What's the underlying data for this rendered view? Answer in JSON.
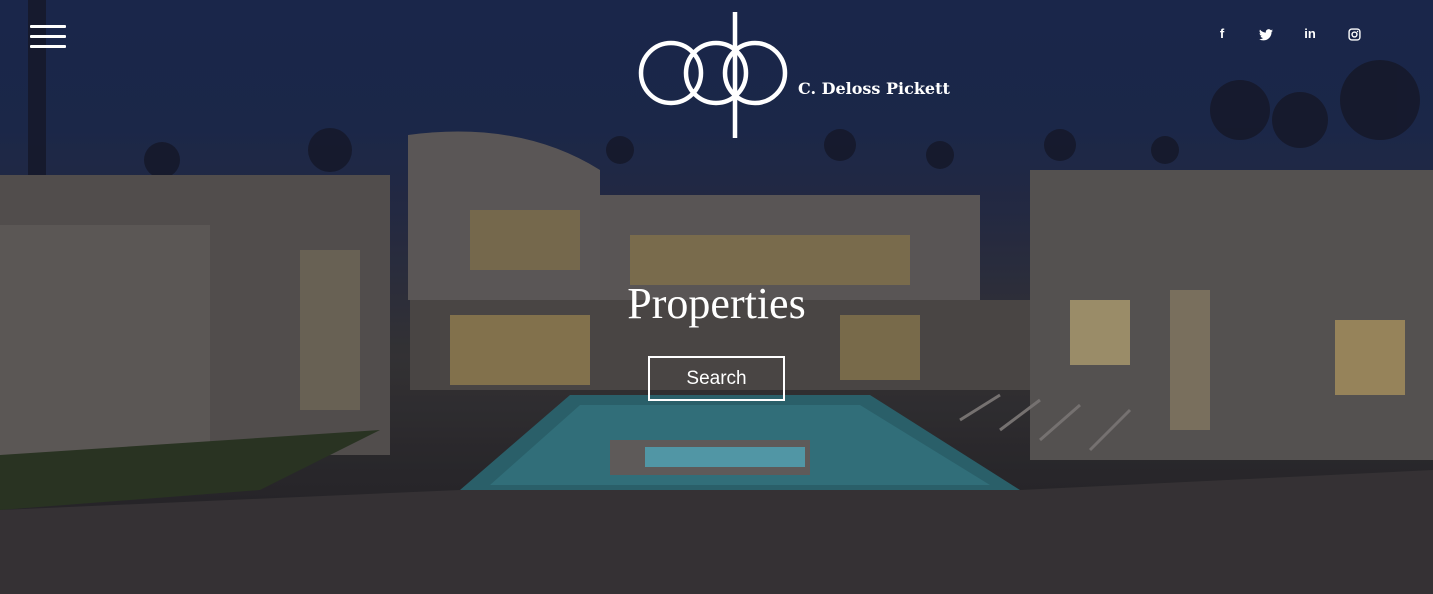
{
  "header": {
    "menu_icon": "hamburger-menu-icon",
    "logo": {
      "name": "C. Deloss Pickett",
      "icon": "cdp-monogram-logo"
    },
    "social": [
      {
        "name": "facebook-icon",
        "glyph": "f"
      },
      {
        "name": "twitter-icon",
        "glyph": ""
      },
      {
        "name": "linkedin-icon",
        "glyph": "in"
      },
      {
        "name": "instagram-icon",
        "glyph": ""
      }
    ]
  },
  "hero": {
    "title": "Properties",
    "search_label": "Search",
    "background": "night-view-luxury-house-with-pool"
  },
  "colors": {
    "text": "#ffffff",
    "sky": "#1b2a52"
  }
}
